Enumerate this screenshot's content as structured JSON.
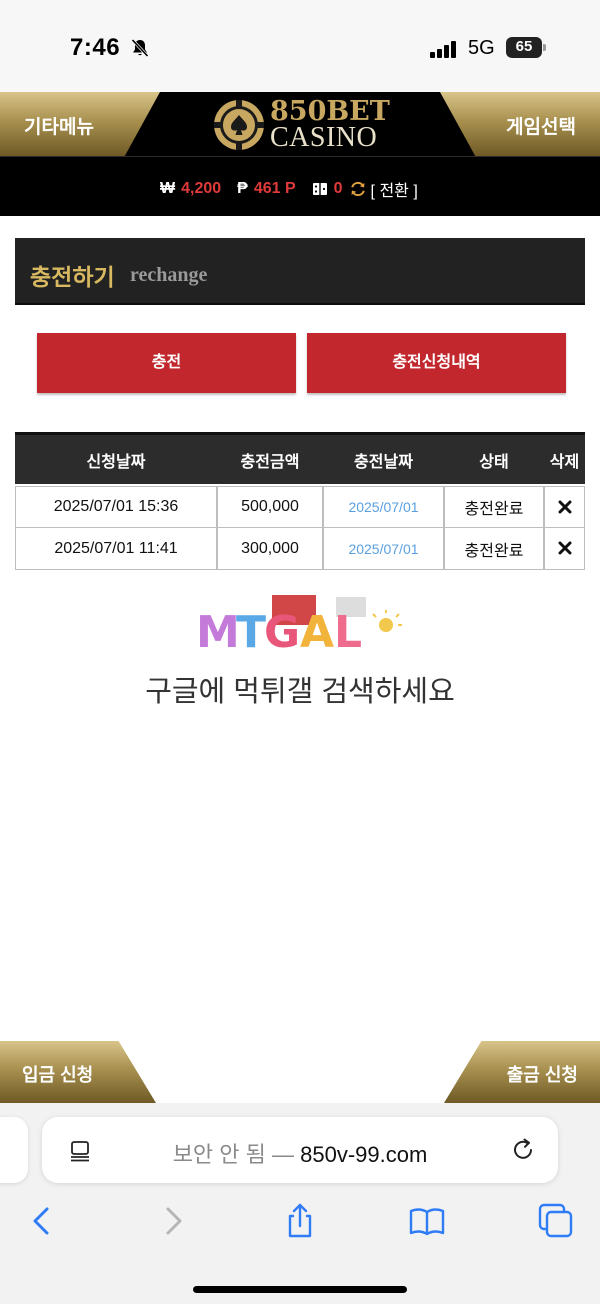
{
  "status_bar": {
    "time": "7:46",
    "network": "5G",
    "battery": "65",
    "icons": [
      "bell-slash-icon",
      "signal-icon",
      "battery-icon"
    ]
  },
  "header": {
    "left_menu": "기타메뉴",
    "right_menu": "게임선택",
    "logo_line1": "850BET",
    "logo_line2": "CASINO",
    "colors": {
      "gold": "#c8a860",
      "background": "#000000"
    }
  },
  "balance": {
    "won_symbol": "₩",
    "won_value": "4,200",
    "point_symbol": "₱",
    "point_value": "461 P",
    "casino_value": "0",
    "switch_label": "[ 전환 ]",
    "value_color": "#e03a3a"
  },
  "section": {
    "title": "충전하기",
    "subtitle": "rechange"
  },
  "buttons": {
    "charge": "충전",
    "history": "충전신청내역",
    "color": "#c1272d"
  },
  "table": {
    "headers": [
      "신청날짜",
      "충전금액",
      "충전날짜",
      "상태",
      "삭제"
    ],
    "rows": [
      {
        "request_date": "2025/07/01 15:36",
        "amount": "500,000",
        "charge_date": "2025/07/01",
        "status": "충전완료"
      },
      {
        "request_date": "2025/07/01 11:41",
        "amount": "300,000",
        "charge_date": "2025/07/01",
        "status": "충전완료"
      }
    ]
  },
  "watermark": {
    "logo": "MTGAL",
    "text": "구글에 먹튀갤 검색하세요"
  },
  "bottom_tabs": {
    "deposit": "입금 신청",
    "withdraw": "출금 신청"
  },
  "browser": {
    "insecure_label": "보안 안 됨 — ",
    "domain": "850v-99.com"
  }
}
